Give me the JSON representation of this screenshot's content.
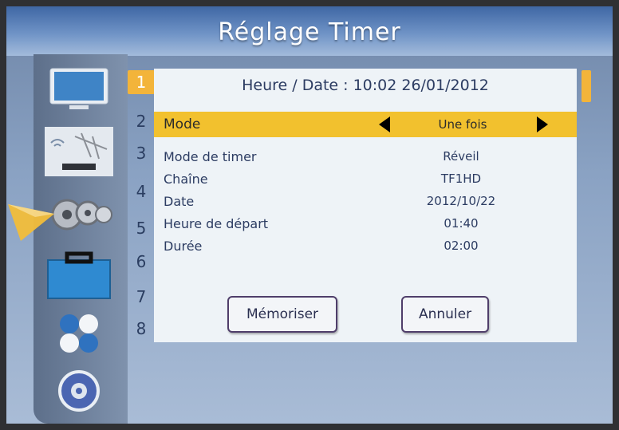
{
  "title": "Réglage Timer",
  "header": "Heure / Date : 10:02  26/01/2012",
  "mode": {
    "label": "Mode",
    "value": "Une fois"
  },
  "fields": [
    {
      "label": "Mode de timer",
      "value": "Réveil"
    },
    {
      "label": "Chaîne",
      "value": "TF1HD"
    },
    {
      "label": "Date",
      "value": "2012/10/22"
    },
    {
      "label": "Heure de départ",
      "value": "01:40"
    },
    {
      "label": "Durée",
      "value": "02:00"
    }
  ],
  "numbers": [
    "1",
    "2",
    "3",
    "4",
    "5",
    "6",
    "7",
    "8"
  ],
  "buttons": {
    "save": "Mémoriser",
    "cancel": "Annuler"
  },
  "sidebar_icons": [
    "tv-icon",
    "antenna-icon",
    "gears-icon",
    "toolbox-icon",
    "balls-icon",
    "disc-icon"
  ],
  "colors": {
    "highlight": "#f2c12e",
    "active_number": "#f3b43a"
  }
}
